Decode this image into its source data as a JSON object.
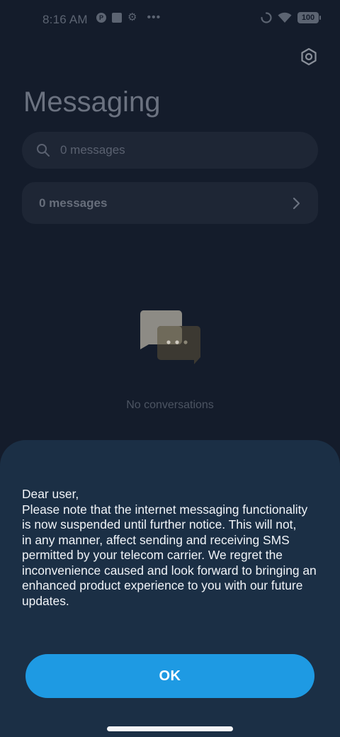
{
  "status_bar": {
    "time": "8:16 AM",
    "battery": "100",
    "icons": [
      "notification-badge-icon",
      "app-square-icon",
      "settings-gear-icon",
      "more-dots-icon",
      "loading-spinner-icon",
      "wifi-icon",
      "battery-icon"
    ],
    "more": "•••"
  },
  "header": {
    "title": "Messaging",
    "settings_icon": "settings-hexagon-icon"
  },
  "search": {
    "placeholder": "0 messages",
    "icon": "search-icon"
  },
  "messages_row": {
    "label": "0 messages",
    "icon": "chevron-right-icon"
  },
  "empty_state": {
    "icon": "chat-bubbles-icon",
    "text": "No conversations"
  },
  "dialog": {
    "lines": [
      "Dear user,",
      "Please note that the internet messaging functionality",
      "is now suspended until further notice. This will not,",
      "in any manner, affect sending and receiving SMS",
      "permitted by your telecom carrier. We regret the",
      "inconvenience caused and look forward to bringing an",
      "enhanced product experience to you with our future",
      "updates."
    ],
    "ok_label": "OK"
  },
  "colors": {
    "background": "#141c2b",
    "sheet": "#1b2f45",
    "accent": "#1e9ae3"
  }
}
